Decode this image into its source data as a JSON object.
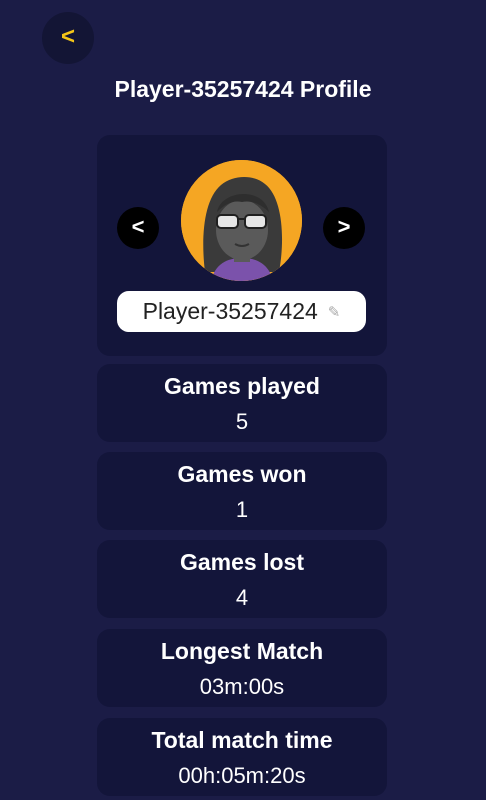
{
  "header": {
    "back_label": "<",
    "title": "Player-35257424 Profile"
  },
  "profile": {
    "prev_label": "<",
    "next_label": ">",
    "avatar_icon": "avatar-glasses-icon",
    "username": "Player-35257424",
    "edit_icon": "pencil-icon"
  },
  "stats": [
    {
      "label": "Games played",
      "value": "5"
    },
    {
      "label": "Games won",
      "value": "1"
    },
    {
      "label": "Games lost",
      "value": "4"
    },
    {
      "label": "Longest Match",
      "value": "03m:00s"
    },
    {
      "label": "Total match time",
      "value": "00h:05m:20s"
    }
  ],
  "colors": {
    "background": "#1b1c46",
    "card": "#13153a",
    "accent": "#f5c518",
    "avatar_bg": "#f5a623"
  }
}
